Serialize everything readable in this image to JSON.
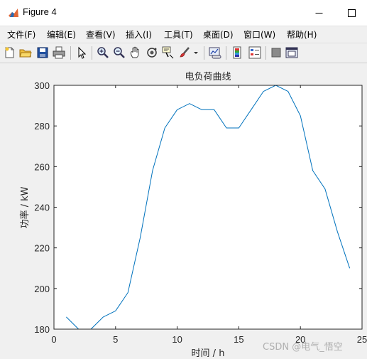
{
  "window": {
    "title": "Figure 4"
  },
  "menu": {
    "items": [
      {
        "label": "文件(F)"
      },
      {
        "label": "编辑(E)"
      },
      {
        "label": "查看(V)"
      },
      {
        "label": "插入(I)"
      },
      {
        "label": "工具(T)"
      },
      {
        "label": "桌面(D)"
      },
      {
        "label": "窗口(W)"
      },
      {
        "label": "帮助(H)"
      }
    ]
  },
  "toolbar": {
    "icons": [
      "new-figure-icon",
      "open-file-icon",
      "save-icon",
      "print-icon",
      "pointer-icon",
      "zoom-in-icon",
      "zoom-out-icon",
      "pan-icon",
      "rotate-3d-icon",
      "data-cursor-icon",
      "brush-icon",
      "dropdown-arrow-icon",
      "link-plot-icon",
      "colorbar-icon",
      "legend-icon",
      "hide-plot-tools-icon",
      "show-plot-tools-icon"
    ]
  },
  "chart_data": {
    "type": "line",
    "title": "电负荷曲线",
    "xlabel": "时间 / h",
    "ylabel": "功率 / kW",
    "xlim": [
      0,
      25
    ],
    "ylim": [
      180,
      300
    ],
    "xticks": [
      0,
      5,
      10,
      15,
      20,
      25
    ],
    "yticks": [
      180,
      200,
      220,
      240,
      260,
      280,
      300
    ],
    "grid": false,
    "series": [
      {
        "color": "#0072bd",
        "x": [
          1,
          2,
          3,
          4,
          5,
          6,
          7,
          8,
          9,
          10,
          11,
          12,
          13,
          14,
          15,
          16,
          17,
          18,
          19,
          20,
          21,
          22,
          23,
          24
        ],
        "y": [
          186,
          180,
          180,
          186,
          189,
          198,
          225,
          258,
          279,
          288,
          291,
          288,
          288,
          279,
          279,
          288,
          297,
          300,
          297,
          285,
          258,
          249,
          228,
          210
        ]
      }
    ]
  },
  "watermark": "CSDN @电气_悟空"
}
